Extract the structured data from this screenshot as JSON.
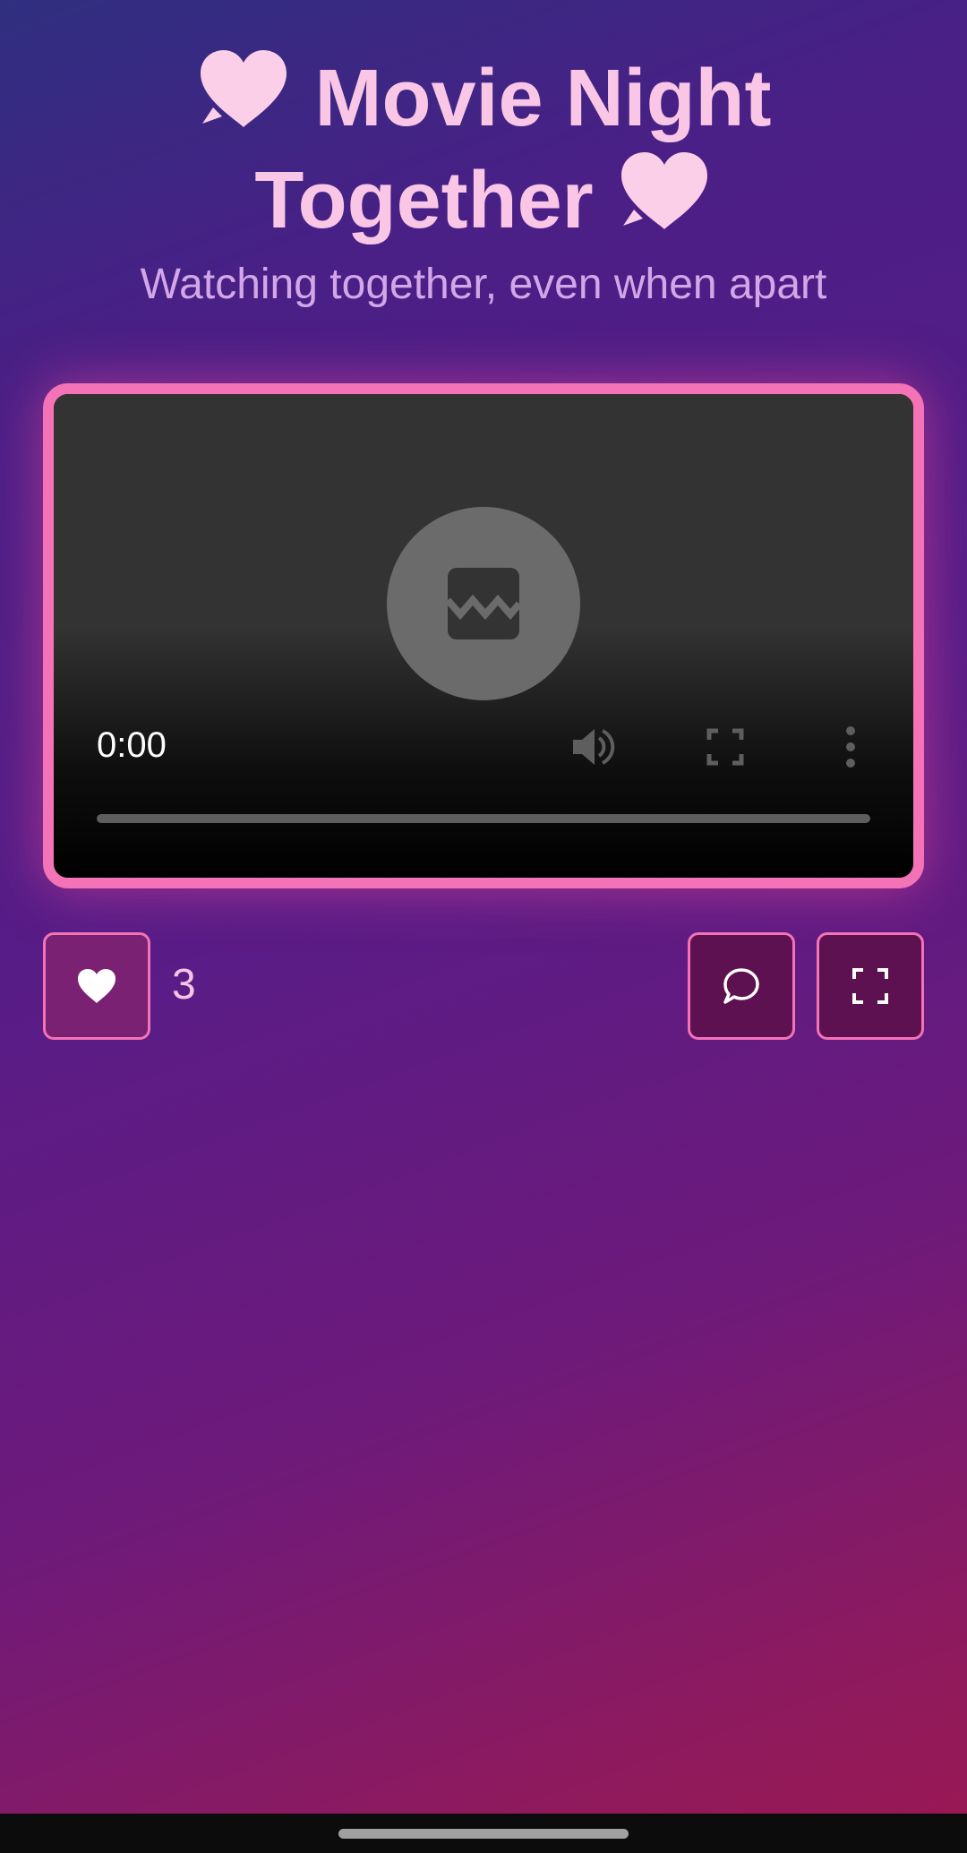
{
  "header": {
    "title_line1": "Movie Night",
    "title_line2": "Together",
    "subtitle": "Watching together, even when apart",
    "accent_color": "#f9c6e6"
  },
  "player": {
    "current_time": "0:00",
    "poster_icon": "broken-image-icon",
    "controls": [
      "volume-icon",
      "fullscreen-icon",
      "more-options-icon"
    ],
    "progress": 0,
    "border_color": "#f472b6"
  },
  "actions": {
    "like_count": "3",
    "like_icon": "heart-icon",
    "chat_icon": "chat-bubble-icon",
    "fullscreen_icon": "fullscreen-icon"
  }
}
